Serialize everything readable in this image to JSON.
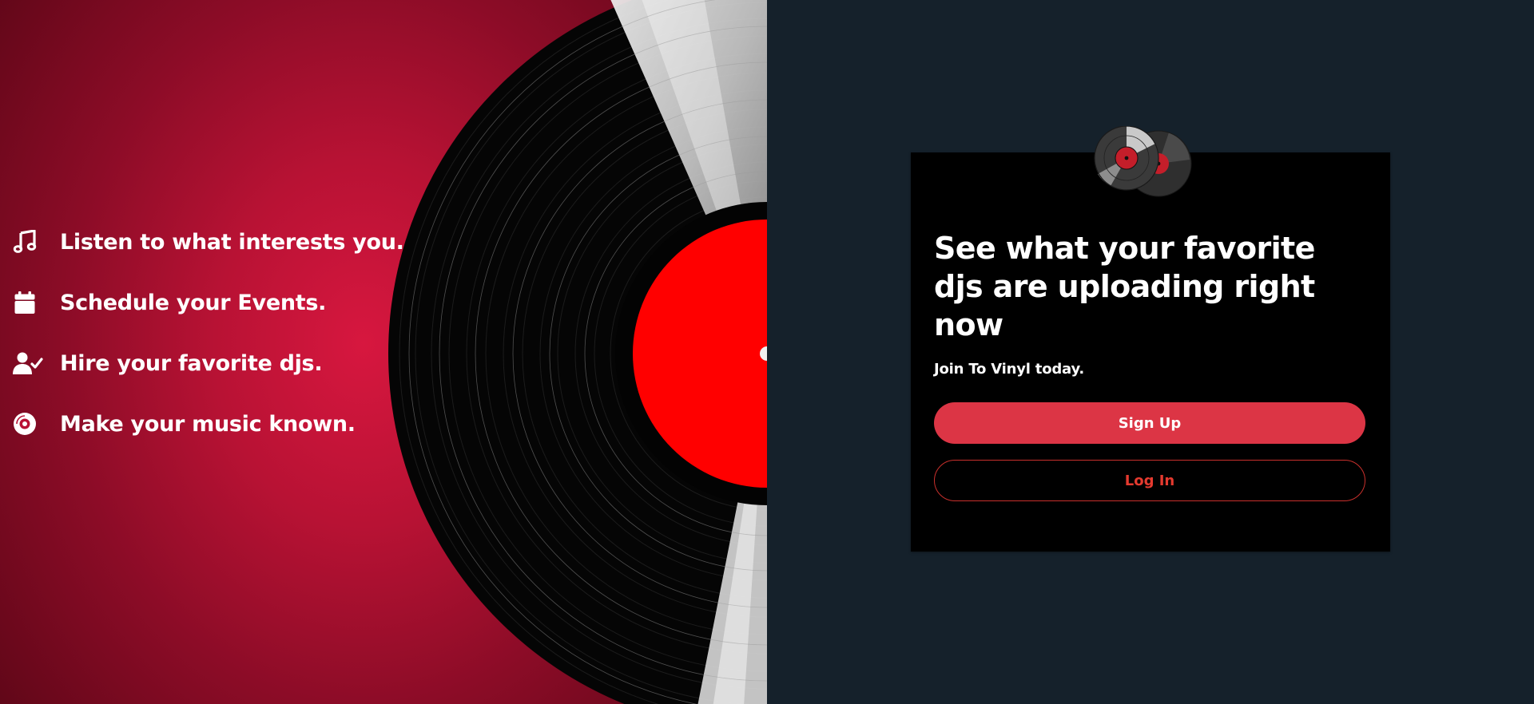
{
  "features": [
    {
      "icon": "music-note-icon",
      "text": "Listen to what interests you."
    },
    {
      "icon": "calendar-icon",
      "text": "Schedule your Events."
    },
    {
      "icon": "user-check-icon",
      "text": "Hire your favorite djs."
    },
    {
      "icon": "record-disc-icon",
      "text": "Make your music known."
    }
  ],
  "card": {
    "logo_icon": "vinyl-records-logo-icon",
    "headline": "See what your favorite djs are uploading right now",
    "subtitle": "Join To Vinyl today.",
    "signup_label": "Sign Up",
    "login_label": "Log In"
  },
  "colors": {
    "left_background": "#b81234",
    "right_background": "#15212b",
    "card_background": "#000000",
    "primary_button": "#dc3545",
    "login_text": "#e53a2f",
    "record_label": "#ff0000"
  }
}
